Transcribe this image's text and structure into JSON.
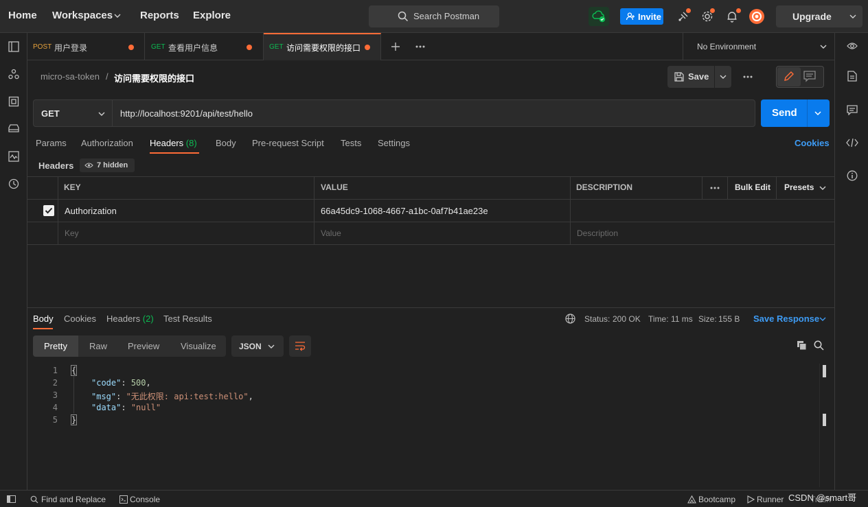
{
  "topbar": {
    "nav": [
      "Home",
      "Workspaces",
      "Reports",
      "Explore"
    ],
    "search_label": "Search Postman",
    "invite_label": "Invite",
    "upgrade_label": "Upgrade"
  },
  "tabs": [
    {
      "method": "POST",
      "method_color": "#e6a23c",
      "title": "用户登录"
    },
    {
      "method": "GET",
      "method_color": "#0cbb52",
      "title": "查看用户信息"
    },
    {
      "method": "GET",
      "method_color": "#0cbb52",
      "title": "访问需要权限的接口"
    }
  ],
  "environment": "No Environment",
  "breadcrumb": {
    "collection": "micro-sa-token",
    "request": "访问需要权限的接口"
  },
  "actions": {
    "save": "Save"
  },
  "request": {
    "method": "GET",
    "url": "http://localhost:9201/api/test/hello",
    "send": "Send"
  },
  "request_tabs": {
    "params": "Params",
    "authorization": "Authorization",
    "headers": "Headers",
    "headers_count": "(8)",
    "body": "Body",
    "prerequest": "Pre-request Script",
    "tests": "Tests",
    "settings": "Settings",
    "cookies": "Cookies"
  },
  "headers_section": {
    "label": "Headers",
    "hidden": "7 hidden"
  },
  "table": {
    "columns": {
      "key": "KEY",
      "value": "VALUE",
      "description": "DESCRIPTION",
      "bulk_edit": "Bulk Edit",
      "presets": "Presets"
    },
    "rows": [
      {
        "key": "Authorization",
        "value": "66a45dc9-1068-4667-a1bc-0af7b41ae23e",
        "checked": true
      }
    ],
    "placeholders": {
      "key": "Key",
      "value": "Value",
      "description": "Description"
    }
  },
  "response": {
    "tabs": {
      "body": "Body",
      "cookies": "Cookies",
      "headers": "Headers",
      "headers_count": "(2)",
      "test_results": "Test Results"
    },
    "status_label": "Status:",
    "status_value": "200 OK",
    "time_label": "Time:",
    "time_value": "11 ms",
    "size_label": "Size:",
    "size_value": "155 B",
    "save_response": "Save Response",
    "views": [
      "Pretty",
      "Raw",
      "Preview",
      "Visualize"
    ],
    "format": "JSON",
    "lines": [
      "1",
      "2",
      "3",
      "4",
      "5"
    ],
    "json": {
      "code_key": "\"code\"",
      "code_val": "500",
      "msg_key": "\"msg\"",
      "msg_val": "\"无此权限: api:test:hello\"",
      "data_key": "\"data\"",
      "data_val": "\"null\""
    }
  },
  "statusbar": {
    "find_replace": "Find and Replace",
    "console": "Console",
    "bootcamp": "Bootcamp",
    "runner": "Runner",
    "trash": "Trash",
    "watermark": "CSDN @smart哥"
  }
}
